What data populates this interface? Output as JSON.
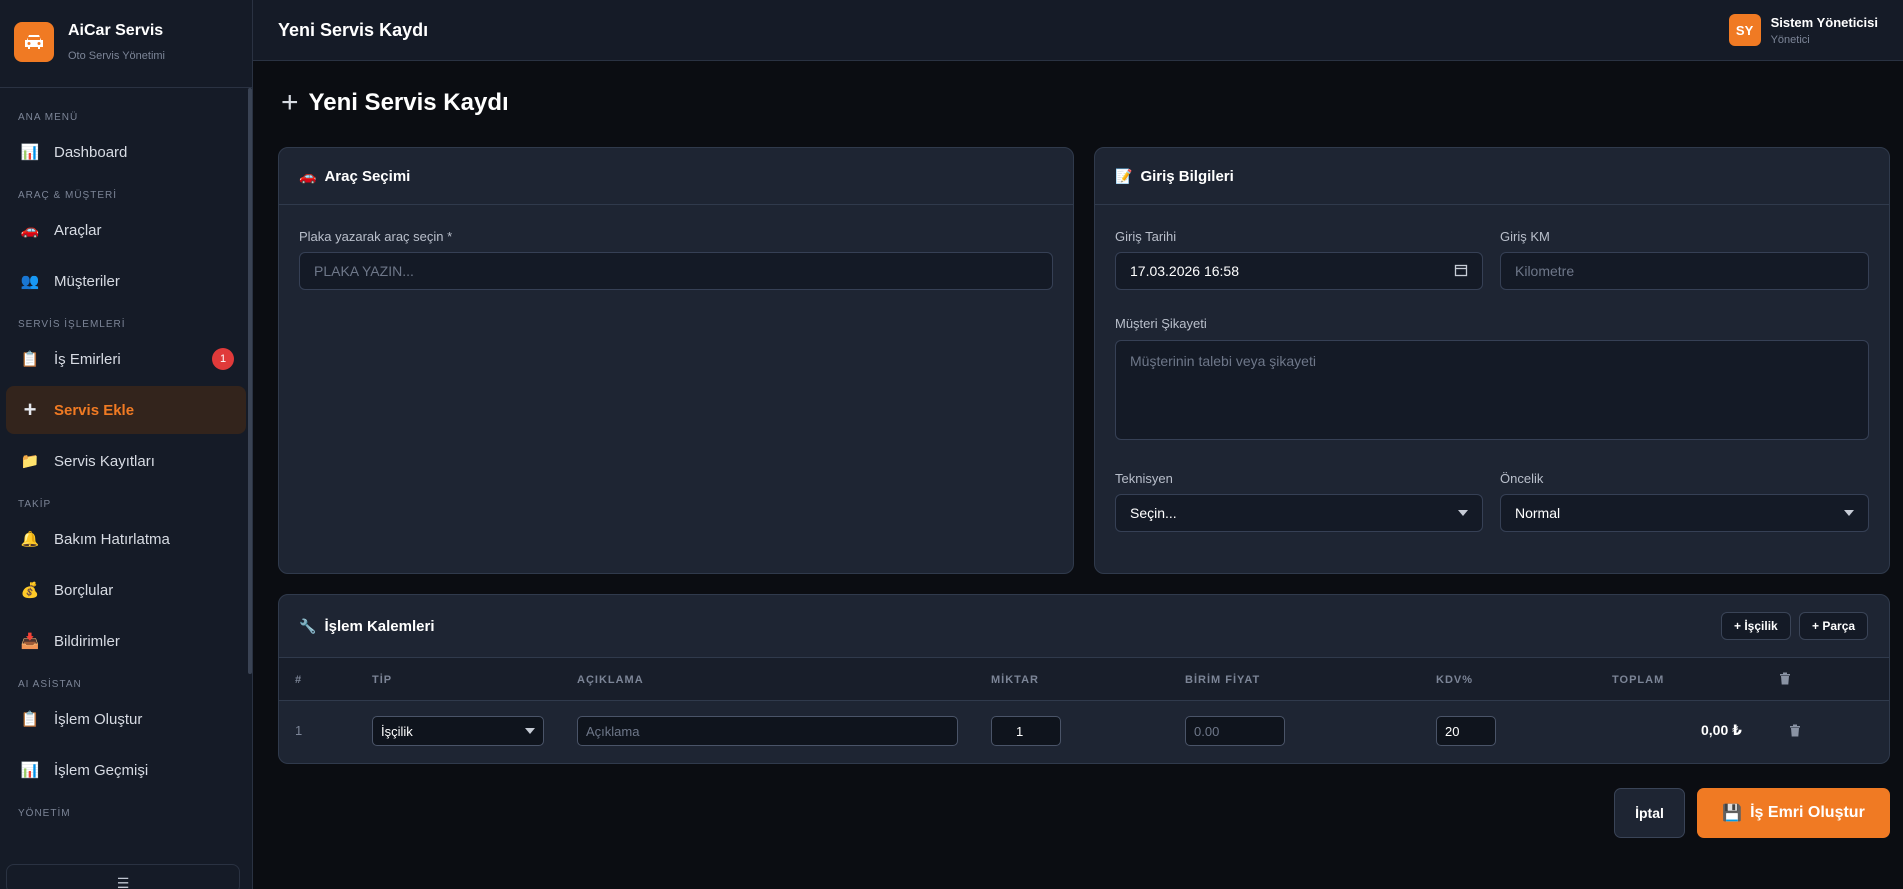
{
  "brand": {
    "name": "AiCar Servis",
    "subtitle": "Oto Servis Yönetimi"
  },
  "sidebar": {
    "sections": [
      {
        "title": "ANA MENÜ"
      },
      {
        "title": "ARAÇ & MÜŞTERİ"
      },
      {
        "title": "SERVİS İŞLEMLERİ"
      },
      {
        "title": "TAKİP"
      },
      {
        "title": "AI ASİSTAN"
      },
      {
        "title": "YÖNETİM"
      }
    ],
    "items": [
      {
        "label": "Dashboard",
        "icon": "bar-chart-icon"
      },
      {
        "label": "Araçlar",
        "icon": "car-icon"
      },
      {
        "label": "Müşteriler",
        "icon": "users-icon"
      },
      {
        "label": "İş Emirleri",
        "icon": "clipboard-icon",
        "badge": "1"
      },
      {
        "label": "Servis Ekle",
        "icon": "plus-icon",
        "active": true
      },
      {
        "label": "Servis Kayıtları",
        "icon": "folder-icon"
      },
      {
        "label": "Bakım Hatırlatma",
        "icon": "bell-icon"
      },
      {
        "label": "Borçlular",
        "icon": "money-bag-icon"
      },
      {
        "label": "Bildirimler",
        "icon": "inbox-icon"
      },
      {
        "label": "İşlem Oluştur",
        "icon": "clipboard-icon"
      },
      {
        "label": "İşlem Geçmişi",
        "icon": "bar-chart-icon"
      }
    ],
    "collapse_label": "☰"
  },
  "topbar": {
    "title": "Yeni Servis Kaydı"
  },
  "user": {
    "initials": "SY",
    "name": "Sistem Yöneticisi",
    "role": "Yönetici"
  },
  "page": {
    "title": "Yeni Servis Kaydı"
  },
  "vehicle_card": {
    "title": "Araç Seçimi",
    "plate_label": "Plaka yazarak araç seçin *",
    "plate_placeholder": "PLAKA YAZIN..."
  },
  "entry_card": {
    "title": "Giriş Bilgileri",
    "date_label": "Giriş Tarihi",
    "date_value": "17.03.2026 16:58",
    "km_label": "Giriş KM",
    "km_placeholder": "Kilometre",
    "complaint_label": "Müşteri Şikayeti",
    "complaint_placeholder": "Müşterinin talebi veya şikayeti",
    "technician_label": "Teknisyen",
    "technician_value": "Seçin...",
    "priority_label": "Öncelik",
    "priority_value": "Normal"
  },
  "items_card": {
    "title": "İşlem Kalemleri",
    "add_labor": "+ İşçilik",
    "add_part": "+ Parça",
    "columns": [
      "#",
      "TİP",
      "AÇIKLAMA",
      "MİKTAR",
      "BİRİM FİYAT",
      "KDV%",
      "TOPLAM"
    ],
    "rows": [
      {
        "index": "1",
        "type": "İşçilik",
        "desc_placeholder": "Açıklama",
        "qty": "1",
        "price_placeholder": "0.00",
        "vat": "20",
        "total": "0,00 ₺"
      }
    ]
  },
  "actions": {
    "cancel": "İptal",
    "submit": "İş Emri Oluştur"
  },
  "colors": {
    "accent": "#f07a23",
    "badge": "#e03a3a"
  }
}
